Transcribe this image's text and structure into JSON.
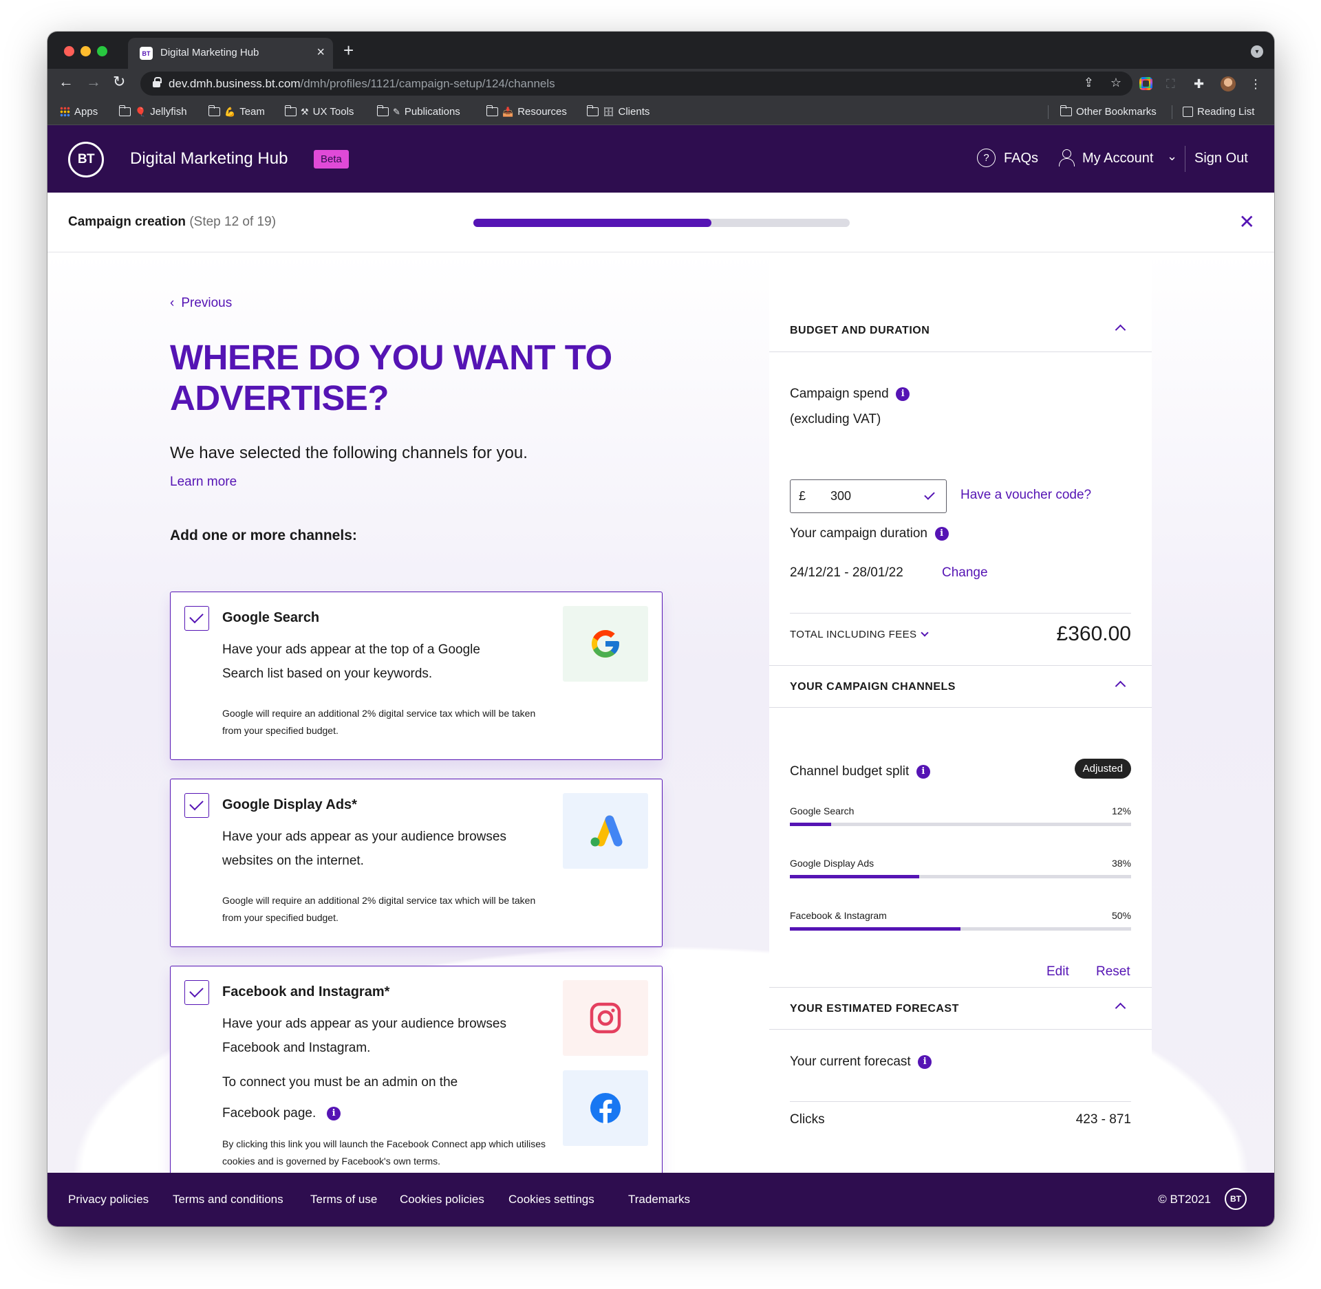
{
  "browser": {
    "tab_title": "Digital Marketing Hub",
    "url_host": "dev.dmh.business.bt.com",
    "url_path": "/dmh/profiles/1121/campaign-setup/124/channels",
    "bookmarks": [
      {
        "label": "Apps",
        "icon": "apps-grid-icon"
      },
      {
        "label": "Jellyfish",
        "icon": "folder-icon"
      },
      {
        "label": "Team",
        "icon": "folder-icon"
      },
      {
        "label": "UX Tools",
        "icon": "folder-icon"
      },
      {
        "label": "Publications",
        "icon": "folder-icon"
      },
      {
        "label": "Resources",
        "icon": "folder-icon"
      },
      {
        "label": "Clients",
        "icon": "folder-icon"
      }
    ],
    "other_bookmarks": "Other Bookmarks",
    "reading_list": "Reading List"
  },
  "header": {
    "logo_text": "BT",
    "site_title": "Digital Marketing Hub",
    "beta_badge": "Beta",
    "faqs": "FAQs",
    "my_account": "My Account",
    "sign_out": "Sign Out"
  },
  "stepper": {
    "label": "Campaign creation",
    "step_text": "(Step 12 of 19)",
    "progress_fraction": 0.632
  },
  "main": {
    "previous": "Previous",
    "headline": "WHERE DO YOU WANT TO ADVERTISE?",
    "intro": "We have selected the following channels for you.",
    "learn_more": "Learn more",
    "add_label": "Add one or more channels:",
    "channels": [
      {
        "title": "Google Search",
        "description": "Have your ads appear at the top of a Google Search list based on your keywords.",
        "note": "Google will require an additional 2% digital service tax which will be taken from your specified budget.",
        "checked": true
      },
      {
        "title": "Google Display Ads*",
        "description": "Have your ads appear as your audience browses websites on the internet.",
        "note": "Google will require an additional 2% digital service tax which will be taken from your specified budget.",
        "checked": true
      },
      {
        "title": "Facebook and Instagram*",
        "description": "Have your ads appear as your audience browses Facebook and Instagram.",
        "admin_note_line1": "To connect you must be an admin on the",
        "admin_note_line2": "Facebook page.",
        "note": "By clicking this link you will launch the Facebook Connect app which utilises cookies and is governed by Facebook's own terms.",
        "checked": true
      }
    ]
  },
  "panel": {
    "budget_title": "BUDGET AND DURATION",
    "campaign_spend_line1": "Campaign spend",
    "campaign_spend_line2": "(excluding VAT)",
    "currency_symbol": "£",
    "spend_value": "300",
    "voucher_link": "Have a voucher code?",
    "duration_label": "Your campaign duration",
    "duration_value": "24/12/21 - 28/01/22",
    "change_link": "Change",
    "total_label": "TOTAL INCLUDING FEES",
    "total_value": "£360.00",
    "channels_title": "YOUR CAMPAIGN CHANNELS",
    "split_label": "Channel budget split",
    "adjusted_badge": "Adjusted",
    "splits": [
      {
        "name": "Google Search",
        "pct_label": "12%",
        "fraction": 0.12
      },
      {
        "name": "Google Display Ads",
        "pct_label": "38%",
        "fraction": 0.38
      },
      {
        "name": "Facebook & Instagram",
        "pct_label": "50%",
        "fraction": 0.5
      }
    ],
    "edit": "Edit",
    "reset": "Reset",
    "forecast_title": "YOUR ESTIMATED FORECAST",
    "current_forecast": "Your current forecast",
    "clicks_label": "Clicks",
    "clicks_value": "423 - 871"
  },
  "footer": {
    "links": [
      "Privacy policies",
      "Terms and conditions",
      "Terms of use",
      "Cookies policies",
      "Cookies settings",
      "Trademarks"
    ],
    "copyright": "© BT2021",
    "logo_text": "BT"
  },
  "colors": {
    "brand_purple": "#5514b4",
    "header_bg": "#2e0d4f",
    "beta_pink": "#e04ad8"
  }
}
